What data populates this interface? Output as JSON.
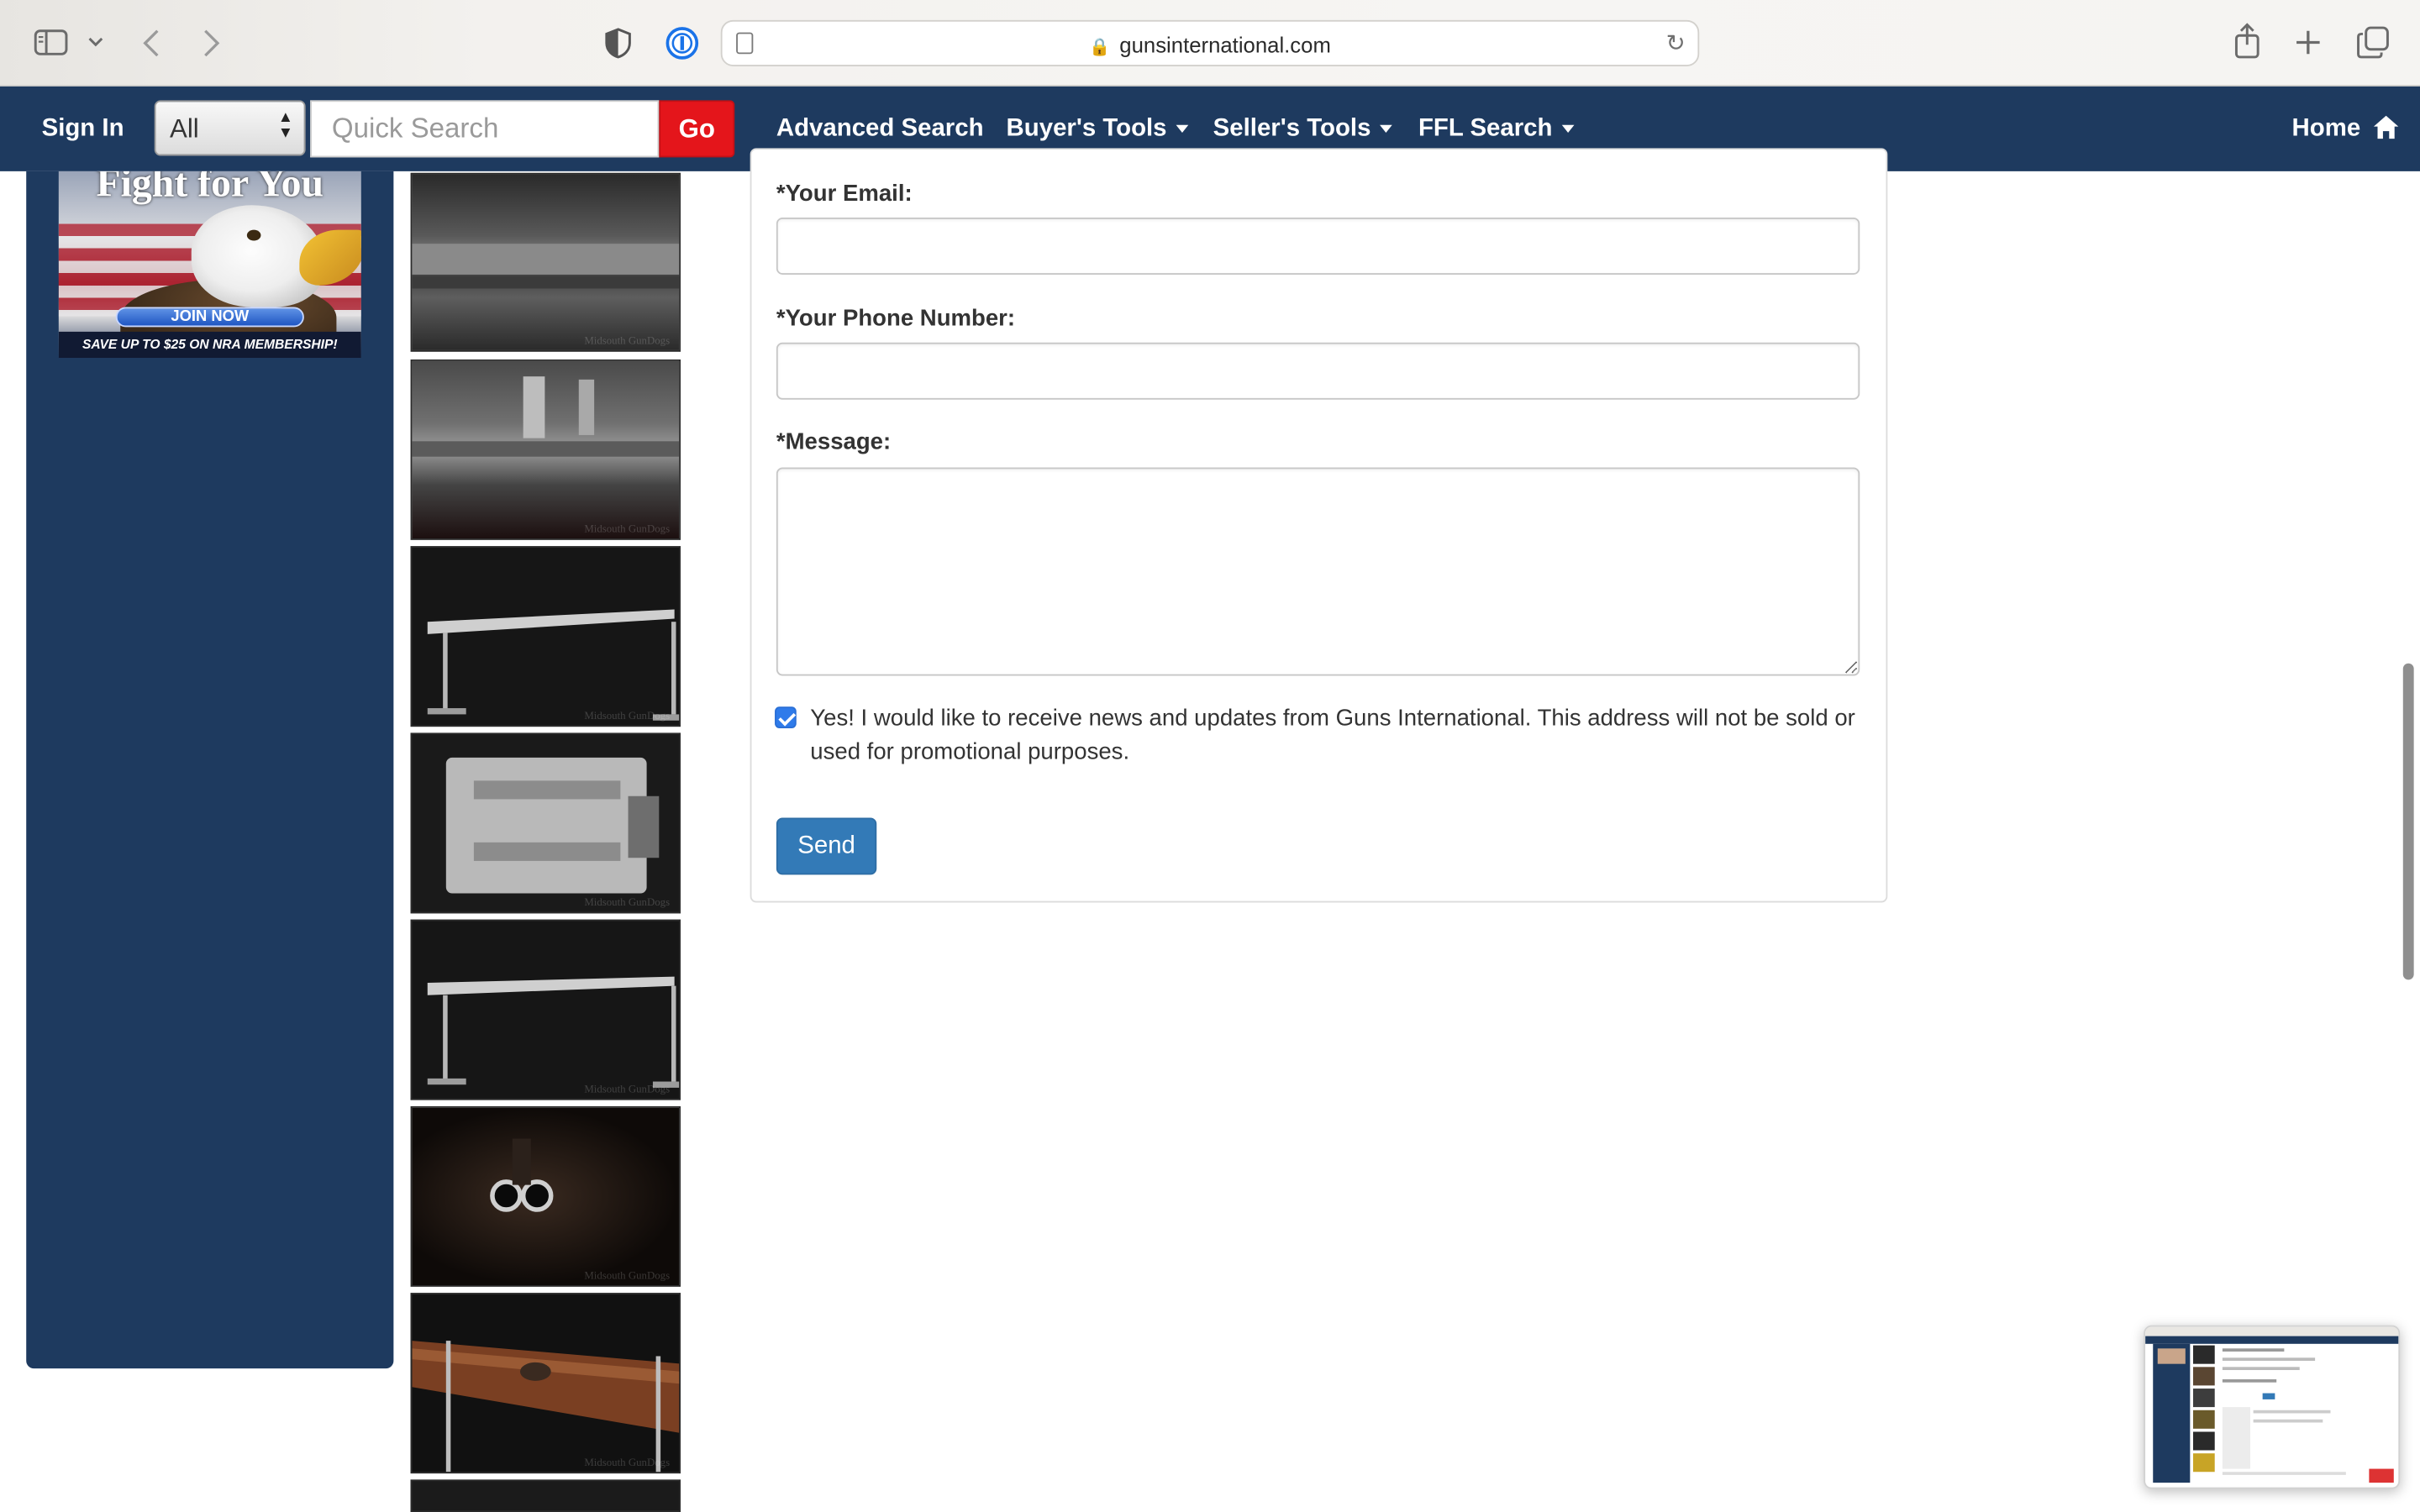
{
  "browser": {
    "url": "gunsinternational.com"
  },
  "nav": {
    "sign_in": "Sign In",
    "category_selected": "All",
    "search_placeholder": "Quick Search",
    "go_label": "Go",
    "links": [
      "Advanced Search",
      "Buyer's Tools",
      "Seller's Tools",
      "FFL Search",
      "Home"
    ]
  },
  "ad": {
    "headline": "Fight for You",
    "cta": "JOIN NOW",
    "tagline": "SAVE UP TO $25 ON NRA MEMBERSHIP!"
  },
  "thumbnails": {
    "watermark": "Midsouth GunDogs"
  },
  "form": {
    "email_label": "*Your Email:",
    "phone_label": "*Your Phone Number:",
    "message_label": "*Message:",
    "optin_text": "Yes! I would like to receive news and updates from Guns International. This address will not be sold or used for promotional purposes.",
    "optin_checked": true,
    "send_label": "Send"
  },
  "colors": {
    "nav_bg": "#1e3a5f",
    "go_button": "#e4151b",
    "send_button": "#337ab7"
  }
}
